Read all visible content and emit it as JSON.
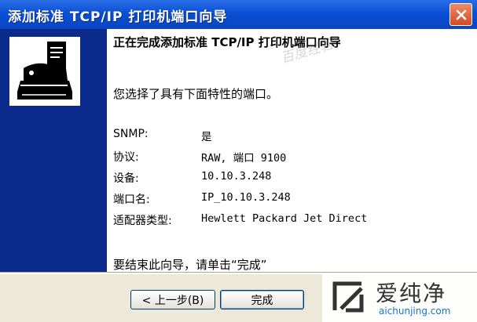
{
  "window": {
    "title": "添加标准 TCP/IP 打印机端口向导",
    "close_icon": "close-icon"
  },
  "content": {
    "heading": "正在完成添加标准 TCP/IP 打印机端口向导",
    "watermark": "百度经验",
    "intro": "您选择了具有下面特性的端口。",
    "properties": [
      {
        "label": "SNMP:",
        "value": "是"
      },
      {
        "label": "协议:",
        "value": "RAW, 端口 9100"
      },
      {
        "label": "设备:",
        "value": "10.10.3.248"
      },
      {
        "label": "端口名:",
        "value": "IP_10.10.3.248"
      },
      {
        "label": "适配器类型:",
        "value": "Hewlett Packard Jet Direct"
      }
    ],
    "finish_text": "要结束此向导，请单击“完成”"
  },
  "buttons": {
    "back": "< 上一步(B)",
    "finish": "完成"
  },
  "logo": {
    "name": "爱纯净",
    "url": "aichunjing.com",
    "accent": "#1a73c8"
  },
  "colors": {
    "titlebar": "#0A4FD4",
    "sidebar": "#0B2B8C",
    "close": "#D24A25"
  }
}
